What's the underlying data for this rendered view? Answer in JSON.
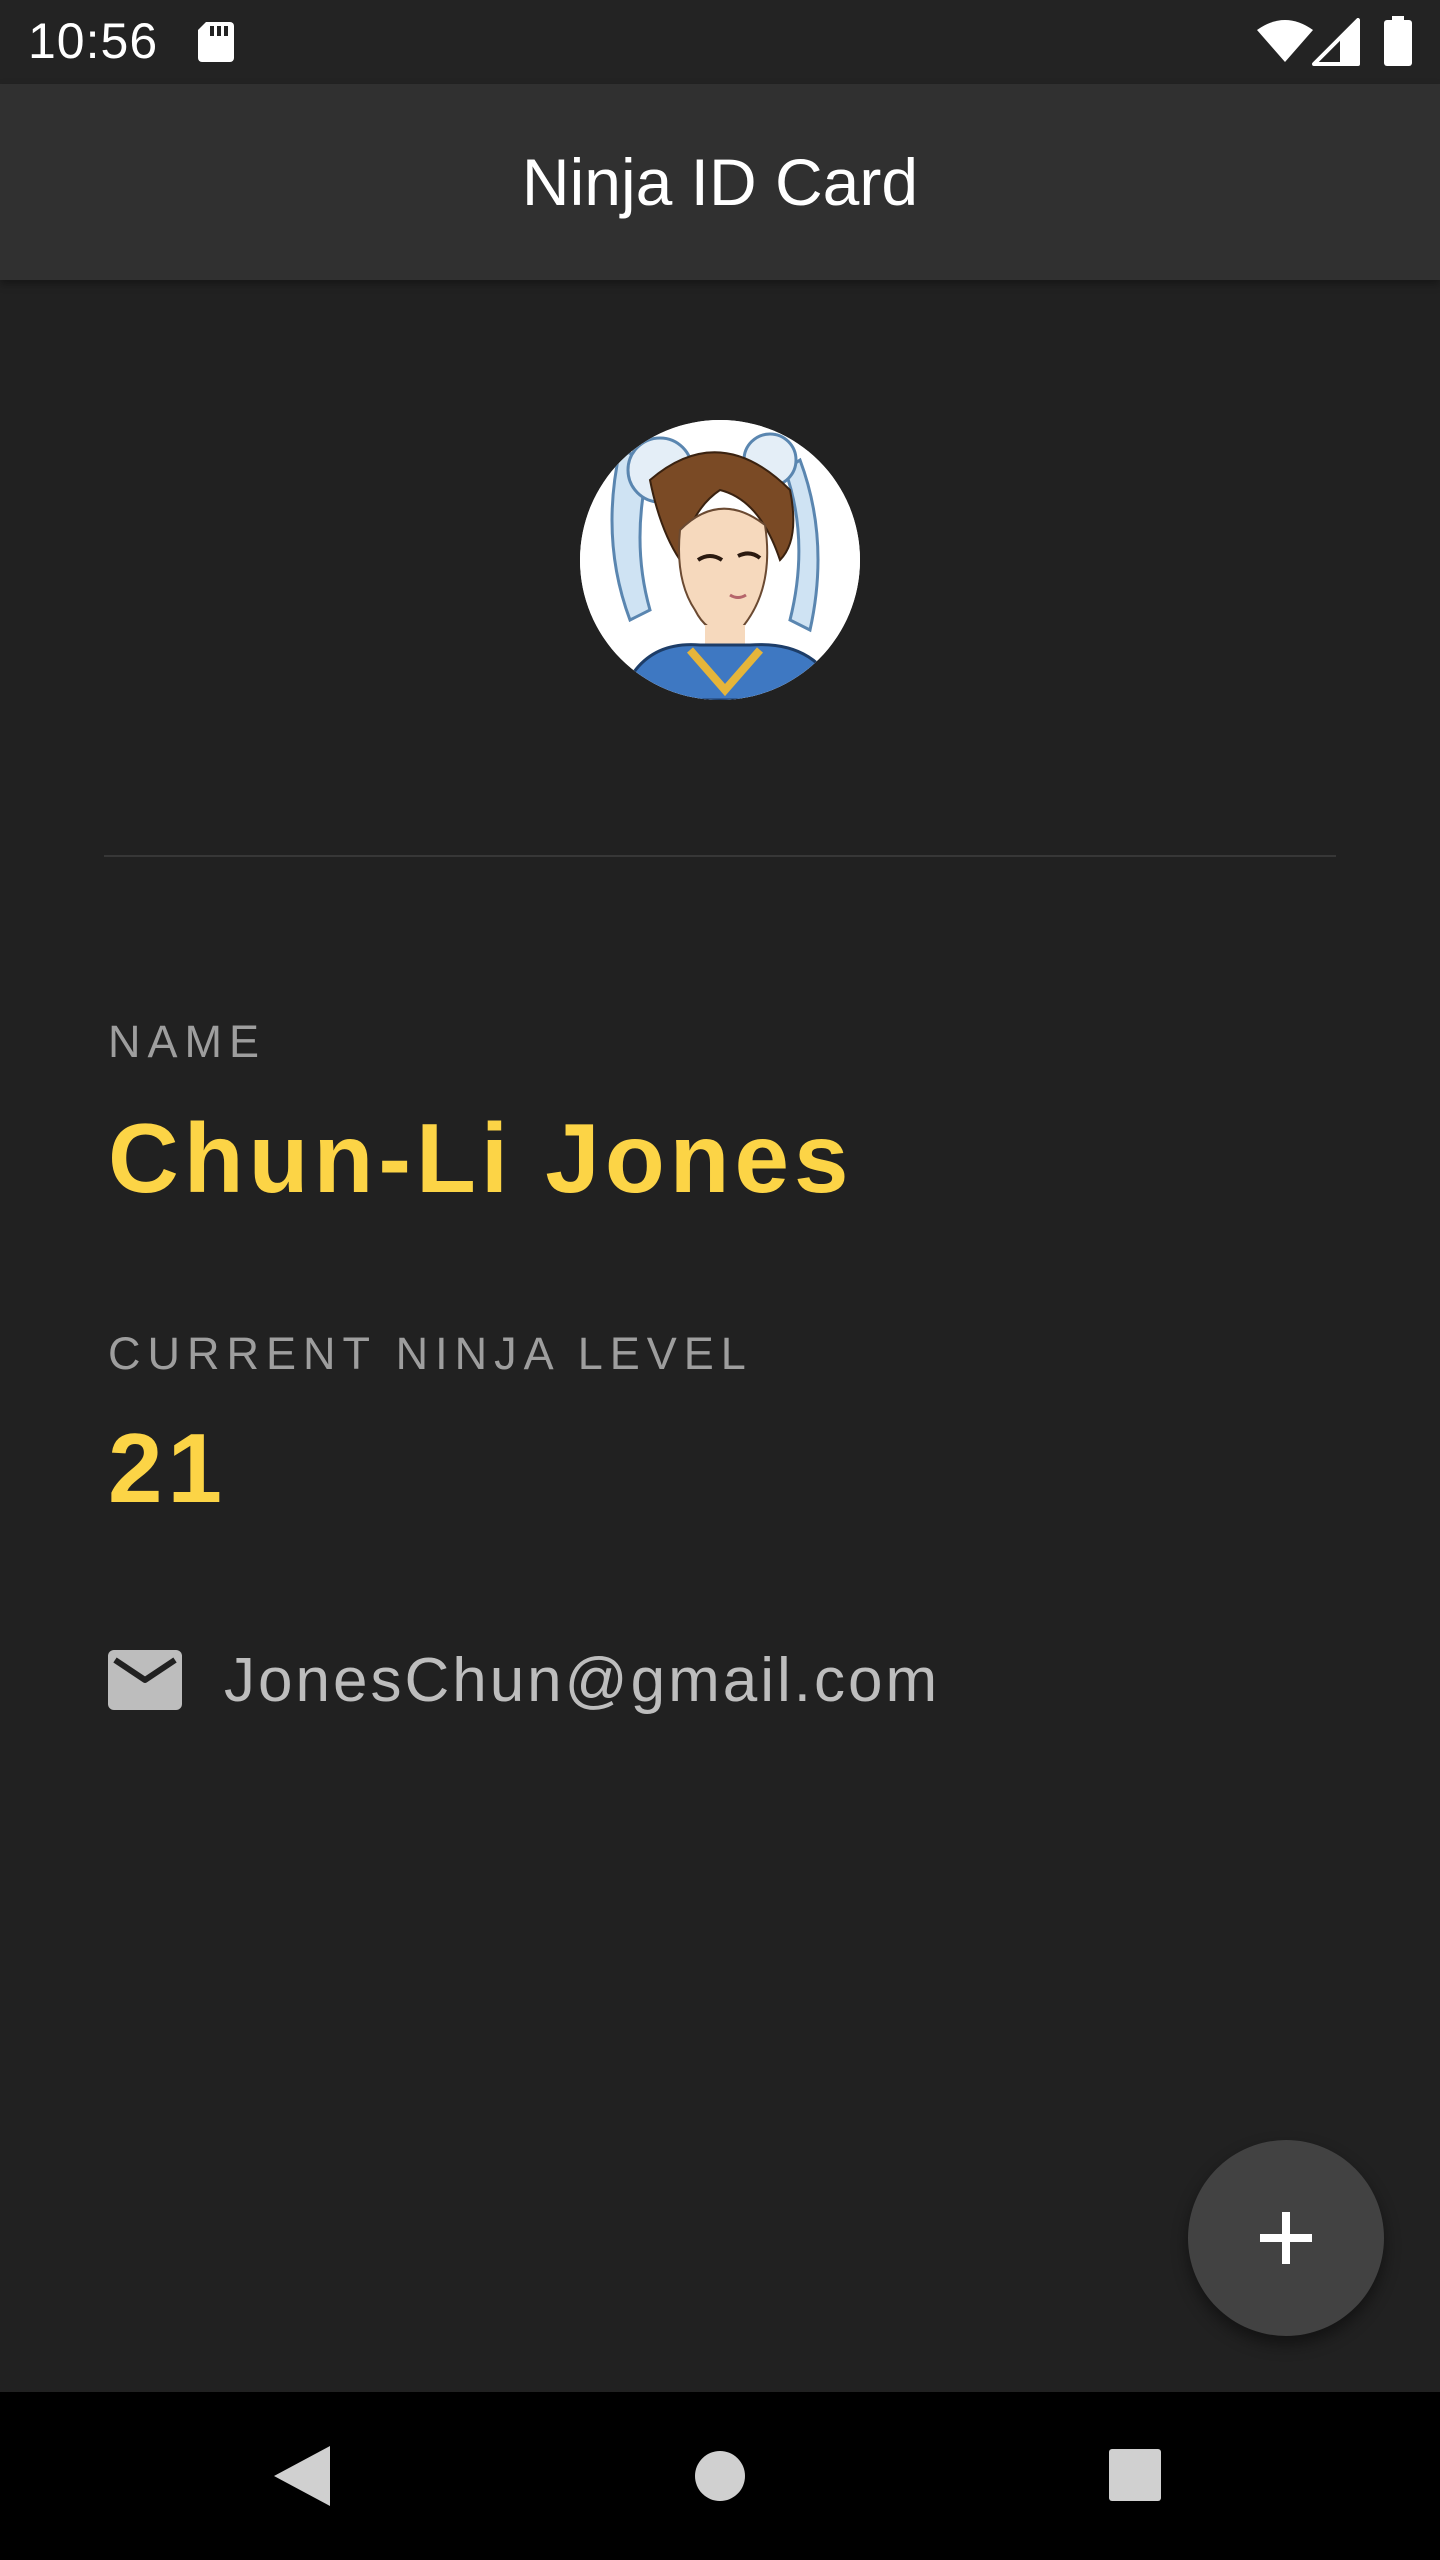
{
  "status_bar": {
    "time": "10:56",
    "icons": [
      "sd-card-icon",
      "wifi-icon",
      "cell-signal-icon",
      "battery-icon"
    ]
  },
  "app_bar": {
    "title": "Ninja ID Card",
    "background": "#303030"
  },
  "profile": {
    "avatar_icon": "avatar-portrait",
    "name_label": "NAME",
    "name_value": "Chun-Li Jones",
    "level_label": "CURRENT NINJA LEVEL",
    "level_value": "21",
    "email_icon": "mail-icon",
    "email": "JonesChun@gmail.com"
  },
  "fab": {
    "icon": "plus-icon",
    "color": "#424242"
  },
  "nav_bar": {
    "icons": [
      "back-icon",
      "home-icon",
      "recents-icon"
    ]
  },
  "colors": {
    "background": "#212121",
    "accent": "#fcd446",
    "label": "#9e9e9e",
    "email_text": "#bdbdbd"
  }
}
